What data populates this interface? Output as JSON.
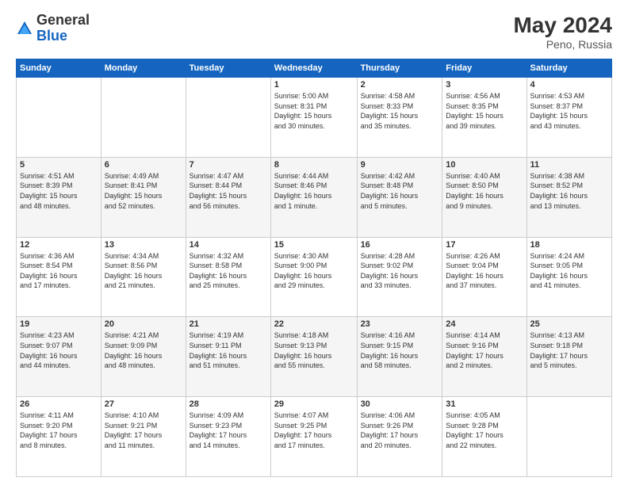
{
  "header": {
    "logo": {
      "general": "General",
      "blue": "Blue"
    },
    "title": "May 2024",
    "location": "Peno, Russia"
  },
  "calendar": {
    "days_of_week": [
      "Sunday",
      "Monday",
      "Tuesday",
      "Wednesday",
      "Thursday",
      "Friday",
      "Saturday"
    ],
    "weeks": [
      [
        {
          "day": "",
          "info": ""
        },
        {
          "day": "",
          "info": ""
        },
        {
          "day": "",
          "info": ""
        },
        {
          "day": "1",
          "info": "Sunrise: 5:00 AM\nSunset: 8:31 PM\nDaylight: 15 hours\nand 30 minutes."
        },
        {
          "day": "2",
          "info": "Sunrise: 4:58 AM\nSunset: 8:33 PM\nDaylight: 15 hours\nand 35 minutes."
        },
        {
          "day": "3",
          "info": "Sunrise: 4:56 AM\nSunset: 8:35 PM\nDaylight: 15 hours\nand 39 minutes."
        },
        {
          "day": "4",
          "info": "Sunrise: 4:53 AM\nSunset: 8:37 PM\nDaylight: 15 hours\nand 43 minutes."
        }
      ],
      [
        {
          "day": "5",
          "info": "Sunrise: 4:51 AM\nSunset: 8:39 PM\nDaylight: 15 hours\nand 48 minutes."
        },
        {
          "day": "6",
          "info": "Sunrise: 4:49 AM\nSunset: 8:41 PM\nDaylight: 15 hours\nand 52 minutes."
        },
        {
          "day": "7",
          "info": "Sunrise: 4:47 AM\nSunset: 8:44 PM\nDaylight: 15 hours\nand 56 minutes."
        },
        {
          "day": "8",
          "info": "Sunrise: 4:44 AM\nSunset: 8:46 PM\nDaylight: 16 hours\nand 1 minute."
        },
        {
          "day": "9",
          "info": "Sunrise: 4:42 AM\nSunset: 8:48 PM\nDaylight: 16 hours\nand 5 minutes."
        },
        {
          "day": "10",
          "info": "Sunrise: 4:40 AM\nSunset: 8:50 PM\nDaylight: 16 hours\nand 9 minutes."
        },
        {
          "day": "11",
          "info": "Sunrise: 4:38 AM\nSunset: 8:52 PM\nDaylight: 16 hours\nand 13 minutes."
        }
      ],
      [
        {
          "day": "12",
          "info": "Sunrise: 4:36 AM\nSunset: 8:54 PM\nDaylight: 16 hours\nand 17 minutes."
        },
        {
          "day": "13",
          "info": "Sunrise: 4:34 AM\nSunset: 8:56 PM\nDaylight: 16 hours\nand 21 minutes."
        },
        {
          "day": "14",
          "info": "Sunrise: 4:32 AM\nSunset: 8:58 PM\nDaylight: 16 hours\nand 25 minutes."
        },
        {
          "day": "15",
          "info": "Sunrise: 4:30 AM\nSunset: 9:00 PM\nDaylight: 16 hours\nand 29 minutes."
        },
        {
          "day": "16",
          "info": "Sunrise: 4:28 AM\nSunset: 9:02 PM\nDaylight: 16 hours\nand 33 minutes."
        },
        {
          "day": "17",
          "info": "Sunrise: 4:26 AM\nSunset: 9:04 PM\nDaylight: 16 hours\nand 37 minutes."
        },
        {
          "day": "18",
          "info": "Sunrise: 4:24 AM\nSunset: 9:05 PM\nDaylight: 16 hours\nand 41 minutes."
        }
      ],
      [
        {
          "day": "19",
          "info": "Sunrise: 4:23 AM\nSunset: 9:07 PM\nDaylight: 16 hours\nand 44 minutes."
        },
        {
          "day": "20",
          "info": "Sunrise: 4:21 AM\nSunset: 9:09 PM\nDaylight: 16 hours\nand 48 minutes."
        },
        {
          "day": "21",
          "info": "Sunrise: 4:19 AM\nSunset: 9:11 PM\nDaylight: 16 hours\nand 51 minutes."
        },
        {
          "day": "22",
          "info": "Sunrise: 4:18 AM\nSunset: 9:13 PM\nDaylight: 16 hours\nand 55 minutes."
        },
        {
          "day": "23",
          "info": "Sunrise: 4:16 AM\nSunset: 9:15 PM\nDaylight: 16 hours\nand 58 minutes."
        },
        {
          "day": "24",
          "info": "Sunrise: 4:14 AM\nSunset: 9:16 PM\nDaylight: 17 hours\nand 2 minutes."
        },
        {
          "day": "25",
          "info": "Sunrise: 4:13 AM\nSunset: 9:18 PM\nDaylight: 17 hours\nand 5 minutes."
        }
      ],
      [
        {
          "day": "26",
          "info": "Sunrise: 4:11 AM\nSunset: 9:20 PM\nDaylight: 17 hours\nand 8 minutes."
        },
        {
          "day": "27",
          "info": "Sunrise: 4:10 AM\nSunset: 9:21 PM\nDaylight: 17 hours\nand 11 minutes."
        },
        {
          "day": "28",
          "info": "Sunrise: 4:09 AM\nSunset: 9:23 PM\nDaylight: 17 hours\nand 14 minutes."
        },
        {
          "day": "29",
          "info": "Sunrise: 4:07 AM\nSunset: 9:25 PM\nDaylight: 17 hours\nand 17 minutes."
        },
        {
          "day": "30",
          "info": "Sunrise: 4:06 AM\nSunset: 9:26 PM\nDaylight: 17 hours\nand 20 minutes."
        },
        {
          "day": "31",
          "info": "Sunrise: 4:05 AM\nSunset: 9:28 PM\nDaylight: 17 hours\nand 22 minutes."
        },
        {
          "day": "",
          "info": ""
        }
      ]
    ]
  }
}
